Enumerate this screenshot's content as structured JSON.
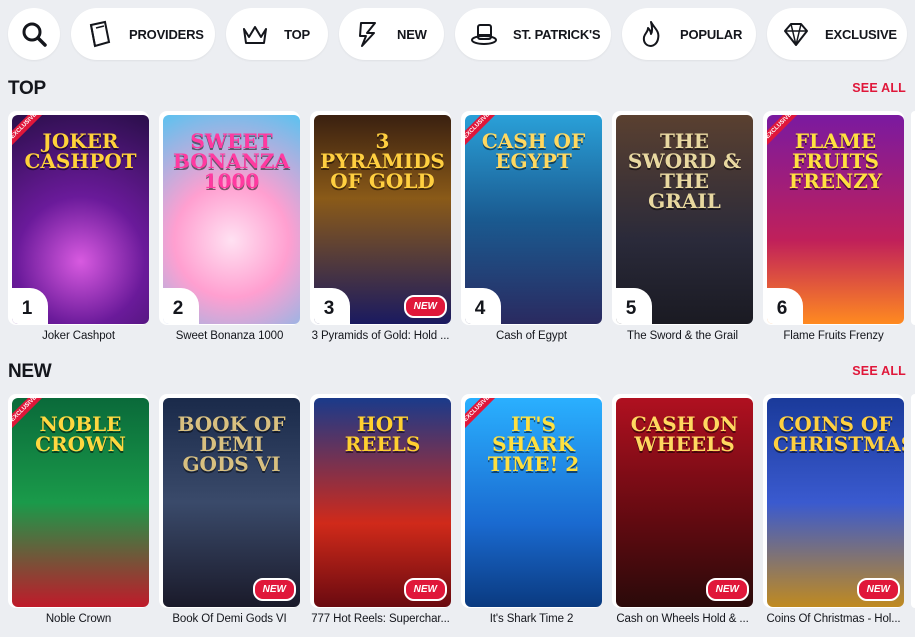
{
  "categories": [
    {
      "label": "PROVIDERS",
      "icon": "book-icon"
    },
    {
      "label": "TOP",
      "icon": "crown-icon"
    },
    {
      "label": "NEW",
      "icon": "lightning-icon"
    },
    {
      "label": "ST. PATRICK'S",
      "icon": "leprechaun-hat-icon"
    },
    {
      "label": "POPULAR",
      "icon": "flame-icon"
    },
    {
      "label": "EXCLUSIVE",
      "icon": "diamond-icon"
    }
  ],
  "sections": {
    "top": {
      "title": "TOP",
      "see_all": "SEE ALL",
      "games": [
        {
          "name": "Joker Cashpot",
          "rank": "1",
          "art_title": "JOKER CASHPOT",
          "new": false,
          "exclusive": true,
          "badge": "EXCLUSIVE"
        },
        {
          "name": "Sweet Bonanza 1000",
          "rank": "2",
          "art_title": "SWEET BONANZA 1000",
          "new": false,
          "exclusive": false
        },
        {
          "name": "3 Pyramids of Gold: Hold ...",
          "rank": "3",
          "art_title": "3 PYRAMIDS OF GOLD",
          "new": true,
          "new_label": "NEW",
          "exclusive": false
        },
        {
          "name": "Cash of Egypt",
          "rank": "4",
          "art_title": "CASH OF EGYPT",
          "new": false,
          "exclusive": true,
          "badge": "EXCLUSIVE"
        },
        {
          "name": "The Sword & the Grail",
          "rank": "5",
          "art_title": "THE SWORD & THE GRAIL",
          "new": false,
          "exclusive": false
        },
        {
          "name": "Flame Fruits Frenzy",
          "rank": "6",
          "art_title": "FLAME FRUITS FRENZY",
          "new": false,
          "exclusive": true,
          "badge": "EXCLUSIVE"
        }
      ]
    },
    "new": {
      "title": "NEW",
      "see_all": "SEE ALL",
      "games": [
        {
          "name": "Noble Crown",
          "art_title": "NOBLE CROWN",
          "new": false,
          "exclusive": true,
          "badge": "EXCLUSIVE"
        },
        {
          "name": "Book Of Demi Gods VI",
          "art_title": "BOOK OF DEMI GODS VI",
          "new": true,
          "new_label": "NEW",
          "exclusive": false
        },
        {
          "name": "777 Hot Reels: Superchar...",
          "art_title": "HOT REELS",
          "new": true,
          "new_label": "NEW",
          "exclusive": false
        },
        {
          "name": "It's Shark Time 2",
          "art_title": "IT'S SHARK TIME! 2",
          "new": false,
          "exclusive": true,
          "badge": "EXCLUSIVE"
        },
        {
          "name": "Cash on Wheels Hold & ...",
          "art_title": "CASH ON WHEELS",
          "new": true,
          "new_label": "NEW",
          "exclusive": false
        },
        {
          "name": "Coins Of Christmas - Hol...",
          "art_title": "COINS OF CHRISTMAS",
          "new": true,
          "new_label": "NEW",
          "exclusive": false
        }
      ]
    }
  },
  "colors": {
    "accent": "#e0173a",
    "background": "#eceef2"
  }
}
